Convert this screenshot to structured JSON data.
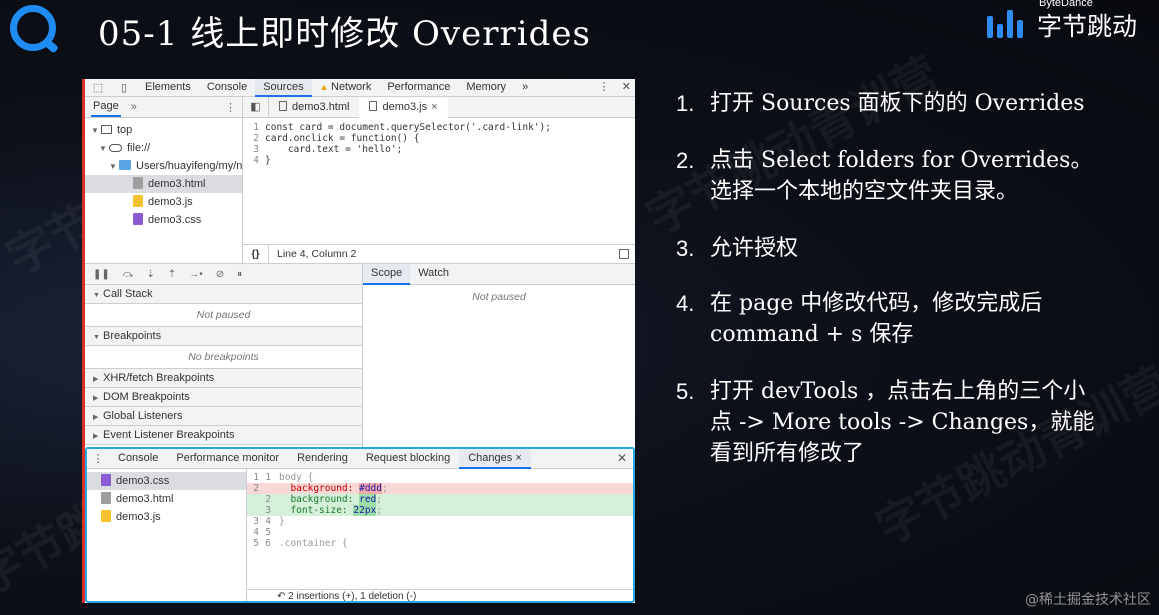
{
  "slide": {
    "title": "05-1 线上即时修改 Overrides",
    "brand_sub": "ByteDance",
    "brand_name": "字节跳动",
    "watermark_text": "字节跳动青训营",
    "footer_watermark": "@稀土掘金技术社区"
  },
  "devtools": {
    "tabs": [
      "Elements",
      "Console",
      "Sources",
      "Network",
      "Performance",
      "Memory"
    ],
    "active_tab": "Sources",
    "more": "»",
    "navigator": {
      "tab": "Page",
      "more": "»",
      "tree": [
        {
          "label": "top",
          "icon": "frame-icon",
          "depth": 0
        },
        {
          "label": "file://",
          "icon": "cloud-icon",
          "depth": 1
        },
        {
          "label": "Users/huayifeng/my/n",
          "icon": "folder-icon",
          "depth": 2
        },
        {
          "label": "demo3.html",
          "icon": "html-file-icon",
          "depth": 3,
          "selected": true
        },
        {
          "label": "demo3.js",
          "icon": "js-file-icon",
          "depth": 3
        },
        {
          "label": "demo3.css",
          "icon": "css-file-icon",
          "depth": 3
        }
      ]
    },
    "editor": {
      "tabs": [
        {
          "label": "demo3.html",
          "closable": false
        },
        {
          "label": "demo3.js",
          "closable": true,
          "close": "×"
        }
      ],
      "lines": [
        {
          "n": "1",
          "code": "const card = document.querySelector('.card-link');"
        },
        {
          "n": "2",
          "code": "card.onclick = function() {"
        },
        {
          "n": "3",
          "code": "    card.text = 'hello';"
        },
        {
          "n": "4",
          "code": "}"
        }
      ],
      "status": "Line 4, Column 2",
      "braces": "{}"
    },
    "debugger": {
      "sections": [
        {
          "title": "Call Stack",
          "body": "Not paused"
        },
        {
          "title": "Breakpoints",
          "body": "No breakpoints"
        },
        {
          "title": "XHR/fetch Breakpoints"
        },
        {
          "title": "DOM Breakpoints"
        },
        {
          "title": "Global Listeners"
        },
        {
          "title": "Event Listener Breakpoints"
        }
      ],
      "scope_tabs": [
        "Scope",
        "Watch"
      ],
      "scope_body": "Not paused"
    },
    "drawer": {
      "tabs": [
        "Console",
        "Performance monitor",
        "Rendering",
        "Request blocking",
        "Changes"
      ],
      "active_tab": "Changes",
      "changes_close": "×",
      "files": [
        "demo3.css",
        "demo3.html",
        "demo3.js"
      ],
      "diff": [
        {
          "n1": "1",
          "n2": "1",
          "text": "body {",
          "type": "ctx"
        },
        {
          "n1": "2",
          "n2": "",
          "prop": "background:",
          "val": "#ddd",
          "type": "del"
        },
        {
          "n1": "",
          "n2": "2",
          "prop": "background:",
          "val": "red",
          "type": "add"
        },
        {
          "n1": "",
          "n2": "3",
          "prop": "font-size:",
          "val": "22px",
          "type": "add"
        },
        {
          "n1": "3",
          "n2": "4",
          "text": "}",
          "type": "ctx"
        },
        {
          "n1": "4",
          "n2": "5",
          "text": "",
          "type": "ctx"
        },
        {
          "n1": "5",
          "n2": "6",
          "text": ".container {",
          "type": "ctx"
        }
      ],
      "footer": "2 insertions (+), 1 deletion (-)"
    }
  },
  "steps": [
    {
      "num": "1.",
      "text": "打开 Sources 面板下的的 Overrides"
    },
    {
      "num": "2.",
      "text": "点击 Select folders for Overrides。选择一个本地的空文件夹目录。"
    },
    {
      "num": "3.",
      "text": "允许授权"
    },
    {
      "num": "4.",
      "text": "在 page 中修改代码，修改完成后 command + s 保存"
    },
    {
      "num": "5.",
      "text": "打开 devTools ，点击右上角的三个小点 -> More tools -> Changes，就能看到所有修改了"
    }
  ]
}
